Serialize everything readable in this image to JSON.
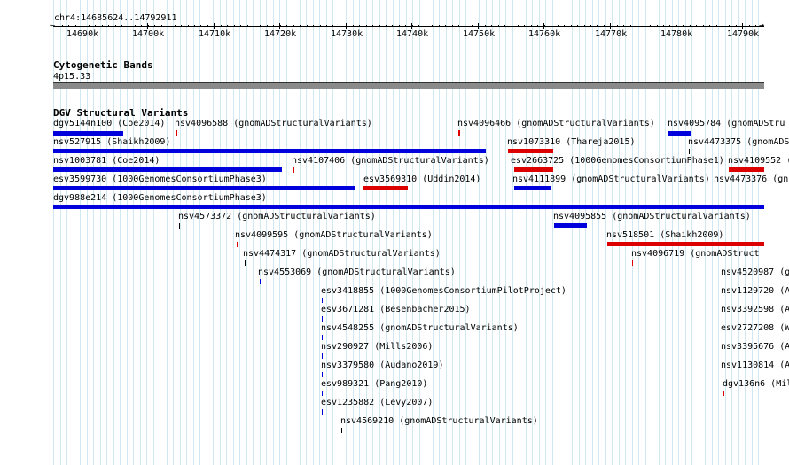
{
  "ruler": {
    "range_label": "chr4:14685624..14792911",
    "tick_labels": [
      "14690k",
      "14700k",
      "14710k",
      "14720k",
      "14730k",
      "14740k",
      "14750k",
      "14760k",
      "14770k",
      "14780k",
      "14790k"
    ],
    "arrow_left": "←",
    "arrow_right": "→"
  },
  "cytobands": {
    "title": "Cytogenetic Bands",
    "band_label": "4p15.33"
  },
  "dgv": {
    "title": "DGV Structural Variants",
    "colors": {
      "blue": "#0000dd",
      "red": "#dd0000"
    },
    "features": [
      {
        "label": "dgv5144n100 (Coe2014)",
        "color": "blue",
        "kind": "bar"
      },
      {
        "label": "nsv4096588 (gnomADStructuralVariants)",
        "color": "red",
        "kind": "tick"
      },
      {
        "label": "nsv4096466 (gnomADStructuralVariants)",
        "color": "red",
        "kind": "tick"
      },
      {
        "label": "nsv4095784 (gnomADStru",
        "color": "blue",
        "kind": "bar"
      },
      {
        "label": "nsv527915 (Shaikh2009)",
        "color": "blue",
        "kind": "bar"
      },
      {
        "label": "nsv1073310 (Thareja2015)",
        "color": "red",
        "kind": "bar"
      },
      {
        "label": "nsv4473375 (gnomADS",
        "color": "black",
        "kind": "tick"
      },
      {
        "label": "nsv1003781 (Coe2014)",
        "color": "blue",
        "kind": "bar"
      },
      {
        "label": "nsv4107406 (gnomADStructuralVariants)",
        "color": "red",
        "kind": "tick"
      },
      {
        "label": "esv2663725 (1000GenomesConsortiumPhase1)",
        "color": "red",
        "kind": "bar"
      },
      {
        "label": "nsv4109552 (",
        "color": "red",
        "kind": "bar"
      },
      {
        "label": "esv3599730 (1000GenomesConsortiumPhase3)",
        "color": "blue",
        "kind": "bar"
      },
      {
        "label": "esv3569310 (Uddin2014)",
        "color": "red",
        "kind": "bar"
      },
      {
        "label": "nsv4111899 (gnomADStructuralVariants)",
        "color": "blue",
        "kind": "bar"
      },
      {
        "label": "nsv4473376 (gn",
        "color": "black",
        "kind": "tick"
      },
      {
        "label": "dgv988e214 (1000GenomesConsortiumPhase3)",
        "color": "blue",
        "kind": "bar"
      },
      {
        "label": "nsv4573372 (gnomADStructuralVariants)",
        "color": "black",
        "kind": "tick"
      },
      {
        "label": "nsv4095855 (gnomADStructuralVariants)",
        "color": "blue",
        "kind": "bar"
      },
      {
        "label": "nsv4099595 (gnomADStructuralVariants)",
        "color": "red",
        "kind": "tick"
      },
      {
        "label": "nsv518501 (Shaikh2009)",
        "color": "red",
        "kind": "bar"
      },
      {
        "label": "nsv4474317 (gnomADStructuralVariants)",
        "color": "black",
        "kind": "tick"
      },
      {
        "label": "nsv4096719 (gnomADStruct",
        "color": "red",
        "kind": "tick"
      },
      {
        "label": "nsv4553069 (gnomADStructuralVariants)",
        "color": "blue",
        "kind": "tick"
      },
      {
        "label": "nsv4520987 (g",
        "color": "blue",
        "kind": "tick"
      },
      {
        "label": "esv3418855 (1000GenomesConsortiumPilotProject)",
        "color": "blue",
        "kind": "tick"
      },
      {
        "label": "nsv1129720 (A",
        "color": "red",
        "kind": "tick"
      },
      {
        "label": "esv3671281 (Besenbacher2015)",
        "color": "blue",
        "kind": "tick"
      },
      {
        "label": "nsv3392598 (A",
        "color": "red",
        "kind": "tick"
      },
      {
        "label": "nsv4548255 (gnomADStructuralVariants)",
        "color": "blue",
        "kind": "tick"
      },
      {
        "label": "esv2727208 (W",
        "color": "red",
        "kind": "tick"
      },
      {
        "label": "nsv290927 (Mills2006)",
        "color": "blue",
        "kind": "tick"
      },
      {
        "label": "nsv3395676 (A",
        "color": "red",
        "kind": "tick"
      },
      {
        "label": "nsv3379580 (Audano2019)",
        "color": "blue",
        "kind": "tick"
      },
      {
        "label": "nsv1130814 (A",
        "color": "red",
        "kind": "tick"
      },
      {
        "label": "esv989321 (Pang2010)",
        "color": "blue",
        "kind": "tick"
      },
      {
        "label": "dgv136n6 (Mil",
        "color": "red",
        "kind": "tick"
      },
      {
        "label": "esv1235882 (Levy2007)",
        "color": "blue",
        "kind": "tick"
      },
      {
        "label": "nsv4569210 (gnomADStructuralVariants)",
        "color": "black",
        "kind": "tick"
      }
    ]
  }
}
